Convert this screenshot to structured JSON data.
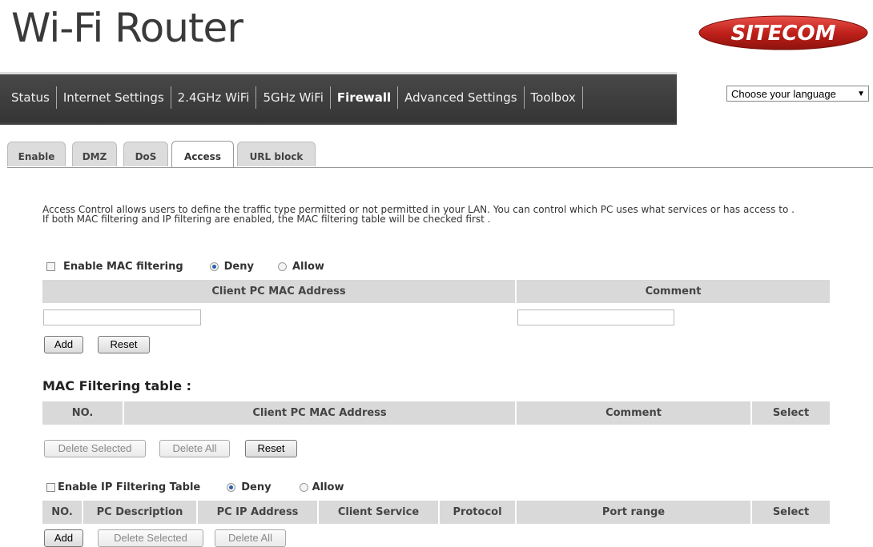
{
  "header": {
    "title": "Wi-Fi Router",
    "logo_text": "SITECOM"
  },
  "nav": {
    "items": [
      "Status",
      "Internet Settings",
      "2.4GHz WiFi",
      "5GHz WiFi",
      "Firewall",
      "Advanced Settings",
      "Toolbox"
    ],
    "active": "Firewall"
  },
  "language": {
    "selected": "Choose your language"
  },
  "tabs": {
    "items": [
      "Enable",
      "DMZ",
      "DoS",
      "Access",
      "URL block"
    ],
    "active": "Access"
  },
  "description": {
    "line1": "Access Control allows users to define the traffic type permitted or not permitted in your LAN. You can control which PC uses what services or has access to .",
    "line2": "If both MAC filtering and IP filtering are enabled, the MAC filtering table will be checked first ."
  },
  "mac_filter": {
    "enable_label": "Enable MAC filtering",
    "deny_label": "Deny",
    "allow_label": "Allow",
    "col_mac": "Client PC MAC Address",
    "col_comment": "Comment",
    "add_label": "Add",
    "reset_label": "Reset"
  },
  "mac_table": {
    "heading": "MAC Filtering table :",
    "col_no": "NO.",
    "col_mac": "Client PC MAC Address",
    "col_comment": "Comment",
    "col_select": "Select",
    "delete_selected_label": "Delete Selected",
    "delete_all_label": "Delete All",
    "reset_label": "Reset"
  },
  "ip_filter": {
    "enable_label": "Enable IP Filtering Table",
    "deny_label": "Deny",
    "allow_label": "Allow",
    "col_no": "NO.",
    "col_desc": "PC Description",
    "col_ip": "PC IP Address",
    "col_service": "Client Service",
    "col_protocol": "Protocol",
    "col_port": "Port range",
    "col_select": "Select",
    "add_label": "Add",
    "delete_selected_label": "Delete Selected",
    "delete_all_label": "Delete All"
  },
  "colors": {
    "logo_red": "#c0201a",
    "nav_bg": "#3f3f3f",
    "header_gray": "#d9d9d9"
  }
}
